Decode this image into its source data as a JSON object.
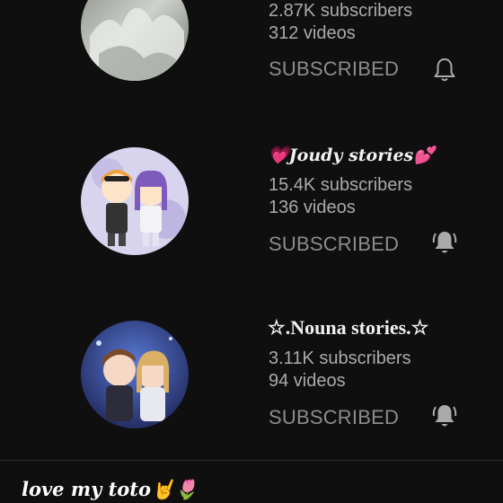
{
  "channels": [
    {
      "name": "",
      "subscribers": "2.87K subscribers",
      "videos": "312 videos",
      "button_label": "SUBSCRIBED",
      "bell_icon": "bell-outline-icon"
    },
    {
      "name": "💗Joudy stories💕",
      "subscribers": "15.4K subscribers",
      "videos": "136 videos",
      "button_label": "SUBSCRIBED",
      "bell_icon": "bell-filled-icon"
    },
    {
      "name": "☆.Nouna stories.☆",
      "subscribers": "3.11K subscribers",
      "videos": "94 videos",
      "button_label": "SUBSCRIBED",
      "bell_icon": "bell-filled-icon"
    }
  ],
  "caption": {
    "text": "love my toto🤘🌷"
  },
  "colors": {
    "background": "#0f0f0f",
    "primary_text": "#f1f1f1",
    "secondary_text": "#aaaaaa",
    "button_text": "#8c8c8c"
  }
}
